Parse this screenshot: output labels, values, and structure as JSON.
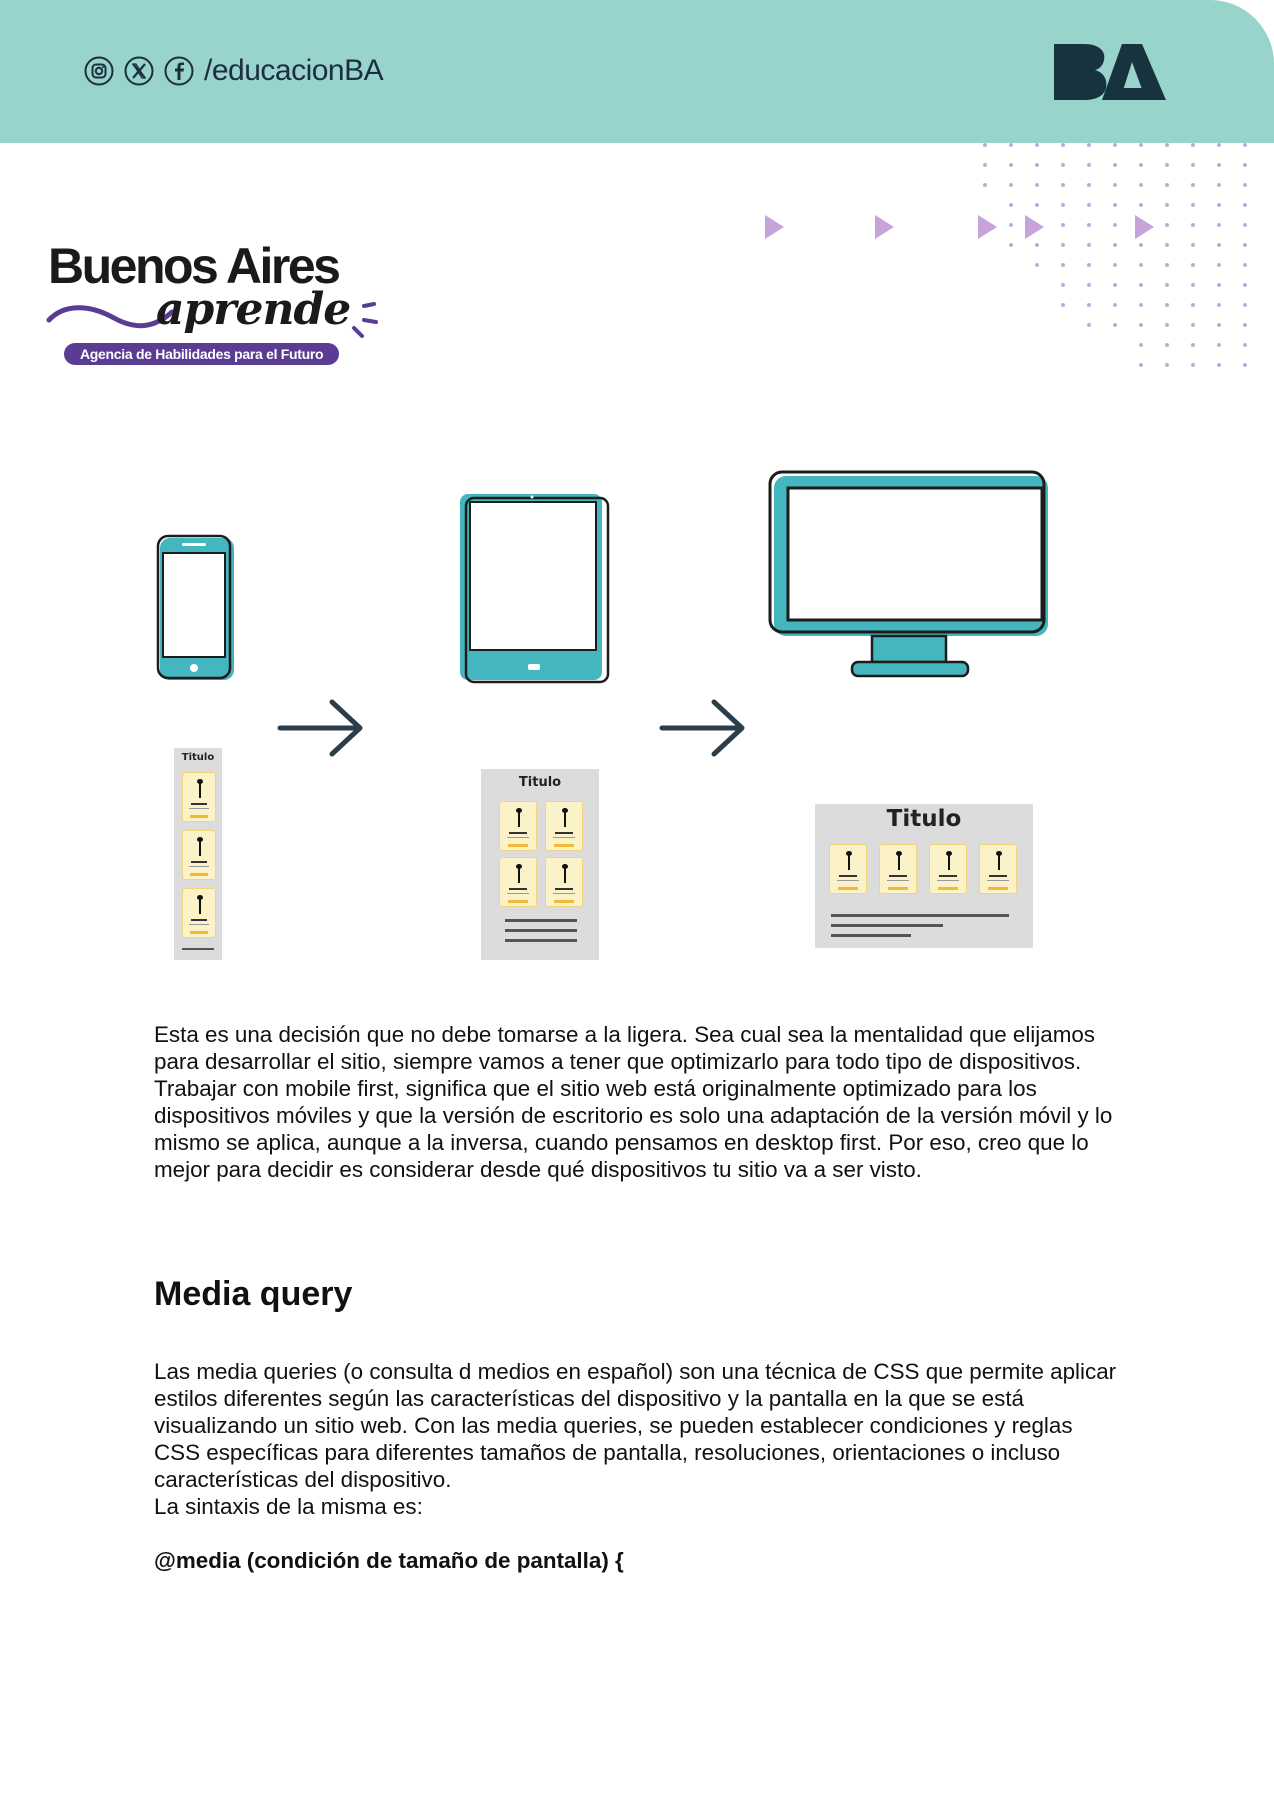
{
  "header": {
    "social_handle": "/educacionBA",
    "icons": [
      "instagram-icon",
      "x-icon",
      "facebook-icon"
    ],
    "background_color": "#98d3cc",
    "brand_logo_text": "BA"
  },
  "logo": {
    "line1": "Buenos Aires",
    "line2": "aprende",
    "tagline": "Agencia de Habilidades para el Futuro"
  },
  "diagram": {
    "devices": [
      "mobile-phone-icon",
      "tablet-icon",
      "desktop-monitor-icon"
    ],
    "mockup_title_mobile": "Titulo",
    "mockup_title_tablet": "Titulo",
    "mockup_title_desktop": "Titulo",
    "accent_color": "#43b6bf"
  },
  "content": {
    "paragraph1": "Esta es una decisión que no debe tomarse a la ligera. Sea cual sea la mentalidad que elijamos para desarrollar el sitio, siempre vamos a tener que optimizarlo para todo tipo de dispositivos. Trabajar con mobile first, significa que el sitio web está originalmente optimizado para los dispositivos móviles y que la versión de escritorio es solo una adaptación de la versión móvil y lo mismo se aplica, aunque a la inversa, cuando pensamos en desktop first. Por eso, creo que lo mejor para decidir es considerar desde qué dispositivos tu sitio va a ser visto.",
    "heading": "Media query",
    "paragraph2": "Las media queries (o consulta d medios en español) son una técnica de CSS que permite aplicar estilos diferentes según las características del dispositivo y la pantalla en la que se está visualizando un sitio web. Con las media queries, se pueden establecer condiciones y reglas CSS específicas para diferentes tamaños de pantalla, resoluciones, orientaciones o incluso características del dispositivo.",
    "paragraph3": "La sintaxis de la misma es:",
    "code_line": "@media (condición de tamaño de pantalla) {"
  }
}
